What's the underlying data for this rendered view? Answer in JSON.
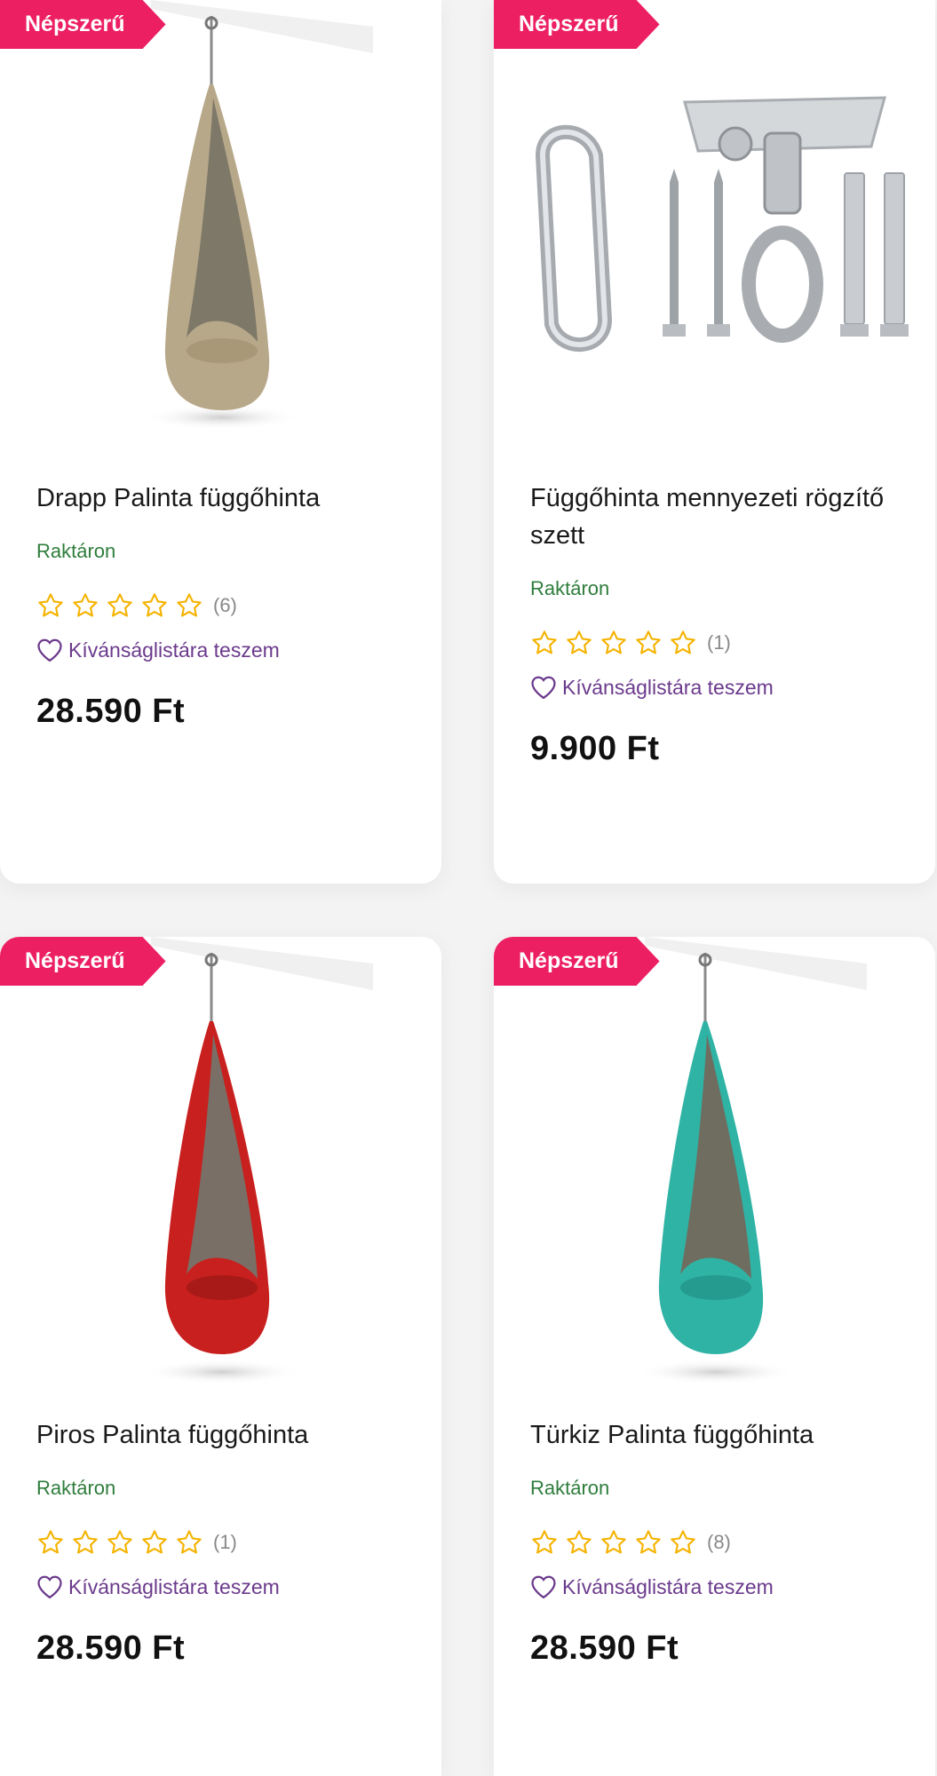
{
  "products": [
    {
      "badge": "Népszerű",
      "title": "Drapp Palinta függőhinta",
      "stock": "Raktáron",
      "rating_count": "(6)",
      "wishlist": "Kívánságlistára teszem",
      "price": "28.590 Ft",
      "color": "#b8a88a"
    },
    {
      "badge": "Népszerű",
      "title": "Függőhinta mennyezeti rögzítő szett",
      "stock": "Raktáron",
      "rating_count": "(1)",
      "wishlist": "Kívánságlistára teszem",
      "price": "9.900 Ft",
      "color": "#c9ccd0"
    },
    {
      "badge": "Népszerű",
      "title": "Piros Palinta függőhinta",
      "stock": "Raktáron",
      "rating_count": "(1)",
      "wishlist": "Kívánságlistára teszem",
      "price": "28.590 Ft",
      "color": "#c8201e"
    },
    {
      "badge": "Népszerű",
      "title": "Türkiz Palinta függőhinta",
      "stock": "Raktáron",
      "rating_count": "(8)",
      "wishlist": "Kívánságlistára teszem",
      "price": "28.590 Ft",
      "color": "#2fb3a5"
    }
  ],
  "colors": {
    "badge": "#ec1f63",
    "stock": "#2f7d3c",
    "star": "#f5b301",
    "wishlist": "#6b3a8c"
  }
}
